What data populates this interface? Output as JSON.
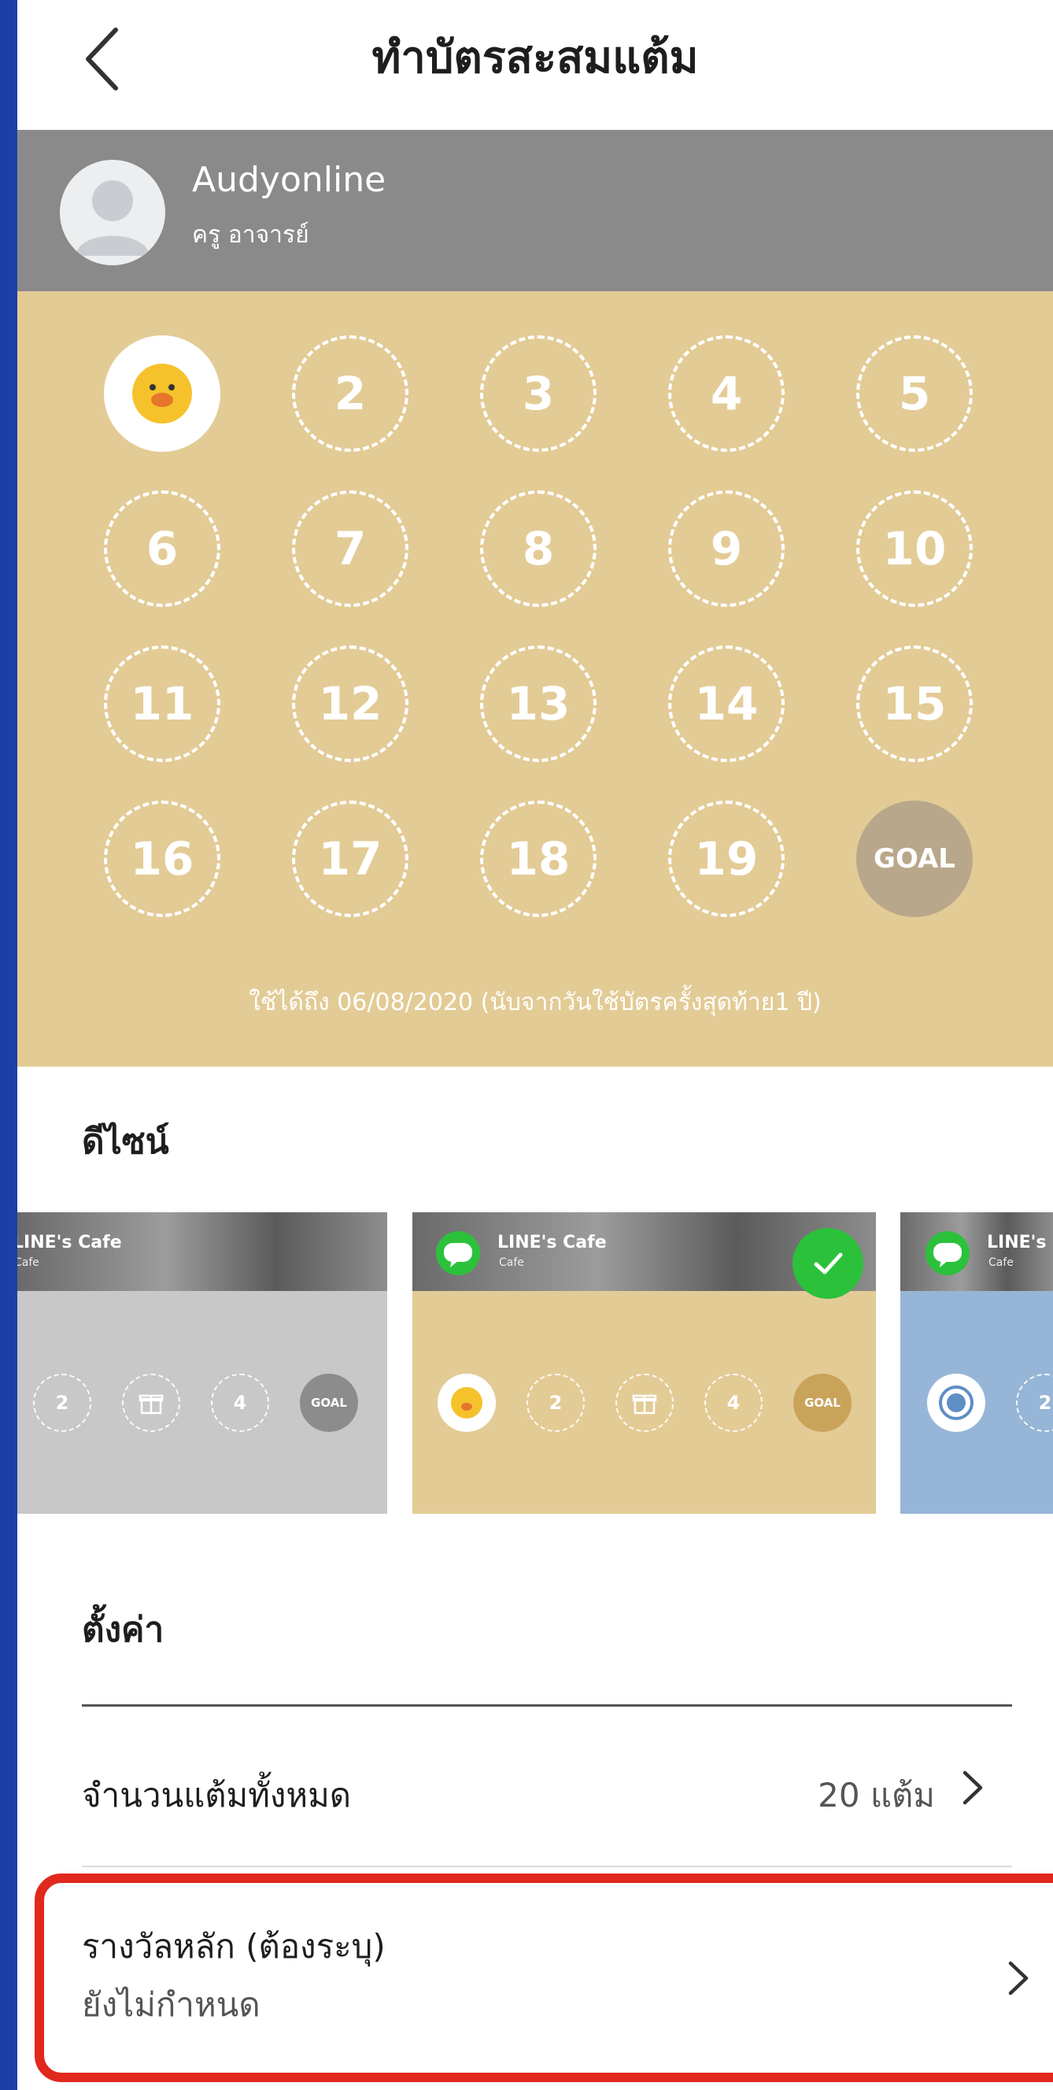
{
  "header": {
    "title": "ทำบัตรสะสมแต้ม"
  },
  "profile": {
    "name": "Audyonline",
    "role": "ครู อาจารย์"
  },
  "card": {
    "stamps": [
      "2",
      "3",
      "4",
      "5",
      "6",
      "7",
      "8",
      "9",
      "10",
      "11",
      "12",
      "13",
      "14",
      "15",
      "16",
      "17",
      "18",
      "19"
    ],
    "goal_label": "GOAL",
    "validity": "ใช้ได้ถึง 06/08/2020 (นับจากวันใช้บัตรครั้งสุดท้าย1 ปี)"
  },
  "design": {
    "section_title": "ดีไซน์",
    "brand": "LINE's Cafe",
    "brand_sub": "Cafe",
    "mini_2": "2",
    "mini_4": "4",
    "mini_goal": "GOAL",
    "third_brand": "LINE's",
    "colors": {
      "gray": "#c8c8c8",
      "gold": "#e3cb96",
      "blue": "#97b5d6",
      "check": "#2cc13b"
    }
  },
  "settings": {
    "section_title": "ตั้งค่า",
    "total_points_label": "จำนวนแต้มทั้งหมด",
    "total_points_value": "20 แต้ม",
    "main_reward_label": "รางวัลหลัก (ต้องระบุ)",
    "main_reward_value": "ยังไม่กำหนด"
  },
  "colors": {
    "card_bg": "#e3cb96",
    "profile_bg": "#8a8a8a",
    "highlight": "#e0281d"
  }
}
